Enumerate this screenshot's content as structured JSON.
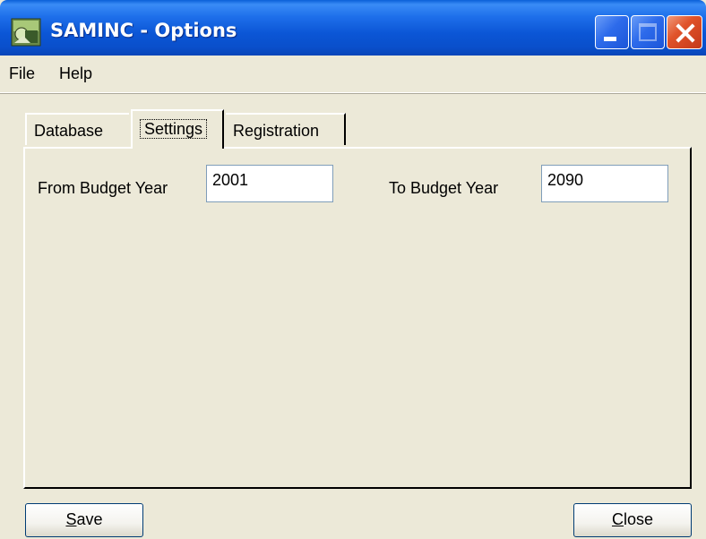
{
  "window": {
    "title": "SAMINC - Options",
    "icon": "app-icon"
  },
  "menu": {
    "items": [
      {
        "label": "File"
      },
      {
        "label": "Help"
      }
    ]
  },
  "tabs": [
    {
      "label": "Database",
      "active": false
    },
    {
      "label": "Settings",
      "active": true
    },
    {
      "label": "Registration",
      "active": false
    }
  ],
  "settings": {
    "from_label": "From Budget Year",
    "from_value": "2001",
    "to_label": "To Budget Year",
    "to_value": "2090"
  },
  "buttons": {
    "save_access": "S",
    "save_rest": "ave",
    "close_access": "C",
    "close_rest": "lose"
  },
  "colors": {
    "titlebar": "#0A5FD8",
    "face": "#ECE9D8",
    "close_button": "#E0532A"
  }
}
